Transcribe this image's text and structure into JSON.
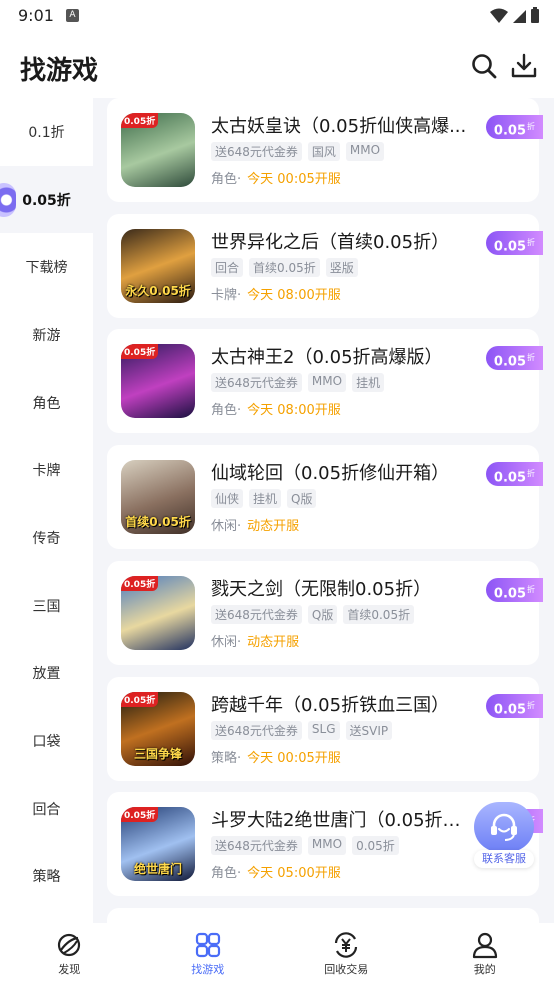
{
  "status": {
    "time": "9:01",
    "notif": "A"
  },
  "header": {
    "title": "找游戏",
    "search_icon": "search-icon",
    "download_icon": "download-icon"
  },
  "sidebar": {
    "items": [
      {
        "label": "0.1折"
      },
      {
        "label": "0.05折",
        "selected": true
      },
      {
        "label": "下载榜"
      },
      {
        "label": "新游"
      },
      {
        "label": "角色"
      },
      {
        "label": "卡牌"
      },
      {
        "label": "传奇"
      },
      {
        "label": "三国"
      },
      {
        "label": "放置"
      },
      {
        "label": "口袋"
      },
      {
        "label": "回合"
      },
      {
        "label": "策略"
      }
    ]
  },
  "games": [
    {
      "name": "太古妖皇诀（0.05折仙侠高爆...",
      "tags": [
        "送648元代金券",
        "国风",
        "MMO"
      ],
      "genre": "角色",
      "open": "今天 00:05开服",
      "discount": "0.05",
      "icon_tag": "0.05折",
      "icon_caption": ""
    },
    {
      "name": "世界异化之后（首续0.05折）",
      "tags": [
        "回合",
        "首续0.05折",
        "竖版"
      ],
      "genre": "卡牌",
      "open": "今天 08:00开服",
      "discount": "0.05",
      "icon_tag": "",
      "icon_caption": "永久0.05折"
    },
    {
      "name": "太古神王2（0.05折高爆版）",
      "tags": [
        "送648元代金券",
        "MMO",
        "挂机"
      ],
      "genre": "角色",
      "open": "今天 08:00开服",
      "discount": "0.05",
      "icon_tag": "0.05折",
      "icon_caption": ""
    },
    {
      "name": "仙域轮回（0.05折修仙开箱）",
      "tags": [
        "仙侠",
        "挂机",
        "Q版"
      ],
      "genre": "休闲",
      "open": "动态开服",
      "discount": "0.05",
      "icon_tag": "",
      "icon_caption": "首续0.05折"
    },
    {
      "name": "戮天之剑（无限制0.05折）",
      "tags": [
        "送648元代金券",
        "Q版",
        "首续0.05折"
      ],
      "genre": "休闲",
      "open": "动态开服",
      "discount": "0.05",
      "icon_tag": "0.05折",
      "icon_caption": ""
    },
    {
      "name": "跨越千年（0.05折铁血三国）",
      "tags": [
        "送648元代金券",
        "SLG",
        "送SVIP"
      ],
      "genre": "策略",
      "open": "今天 00:05开服",
      "discount": "0.05",
      "icon_tag": "0.05折",
      "icon_caption": "三国争锋"
    },
    {
      "name": "斗罗大陆2绝世唐门（0.05折扣...",
      "tags": [
        "送648元代金券",
        "MMO",
        "0.05折"
      ],
      "genre": "角色",
      "open": "今天 05:00开服",
      "discount": "0.05",
      "icon_tag": "0.05折",
      "icon_caption": "绝世唐门"
    }
  ],
  "discount_unit": "折",
  "genre_sep": "·",
  "service": {
    "label": "联系客服",
    "icon": "headset-icon"
  },
  "tabbar": {
    "items": [
      {
        "label": "发现",
        "icon": "planet-icon"
      },
      {
        "label": "找游戏",
        "icon": "grid-icon",
        "active": true
      },
      {
        "label": "回收交易",
        "icon": "yen-exchange-icon"
      },
      {
        "label": "我的",
        "icon": "person-icon"
      }
    ]
  },
  "colors": {
    "accent": "#4a6cf7",
    "open_orange": "#f5a100",
    "discount_purple": "#8c55f5"
  }
}
